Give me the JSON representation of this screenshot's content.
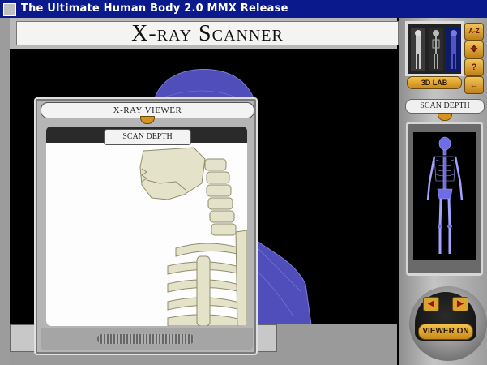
{
  "window": {
    "title": "The Ultimate Human Body 2.0 MMX Release"
  },
  "header": {
    "title": "X-ray Scanner"
  },
  "right_panel": {
    "lab_button": "3D LAB",
    "nav_buttons": [
      {
        "icon": "a-z-index-icon",
        "glyph": "A-Z"
      },
      {
        "icon": "move-arrows-icon",
        "glyph": "✥"
      },
      {
        "icon": "help-icon",
        "glyph": "?"
      },
      {
        "icon": "back-arrow-icon",
        "glyph": "←"
      }
    ],
    "scan_depth_label": "SCAN DEPTH",
    "viewer_toggle_label": "VIEWER ON",
    "dial_left_glyph": "◀",
    "dial_right_glyph": "▶"
  },
  "viewer": {
    "title": "X-RAY VIEWER",
    "scan_depth_label": "SCAN DEPTH"
  },
  "colors": {
    "titlebar": "#0a1a8c",
    "accent_gold": "#d59420",
    "xray_purple": "#5a58c8",
    "bone": "#e4e2c8"
  }
}
